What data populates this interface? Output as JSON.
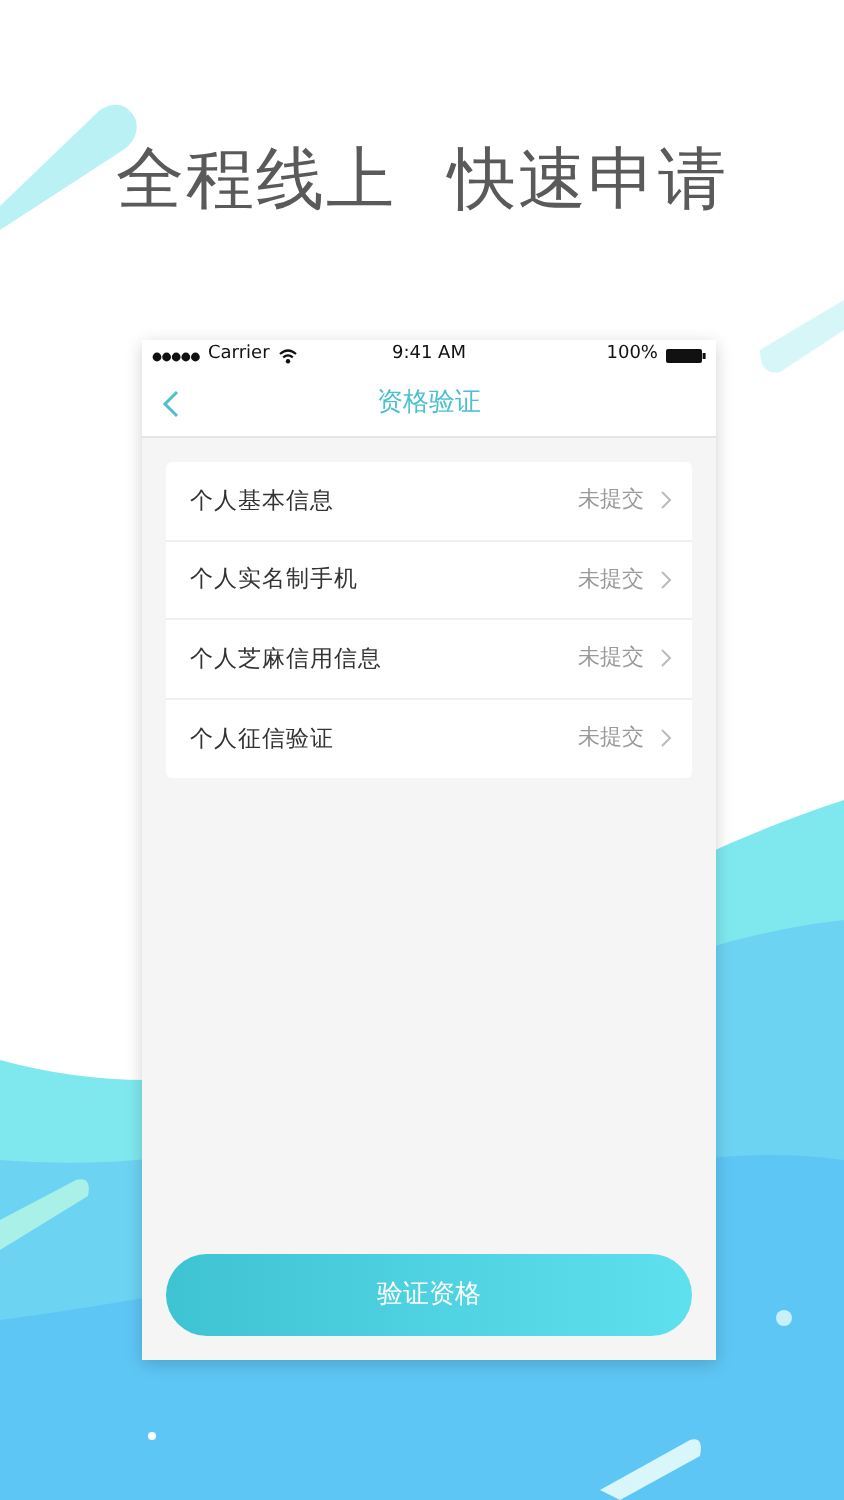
{
  "headline": [
    "全程线上",
    "快速申请"
  ],
  "status_bar": {
    "carrier": "Carrier",
    "time": "9:41 AM",
    "battery": "100%"
  },
  "nav": {
    "title": "资格验证"
  },
  "items": [
    {
      "label": "个人基本信息",
      "status": "未提交"
    },
    {
      "label": "个人实名制手机",
      "status": "未提交"
    },
    {
      "label": "个人芝麻信用信息",
      "status": "未提交"
    },
    {
      "label": "个人征信验证",
      "status": "未提交"
    }
  ],
  "button": {
    "label": "验证资格"
  }
}
